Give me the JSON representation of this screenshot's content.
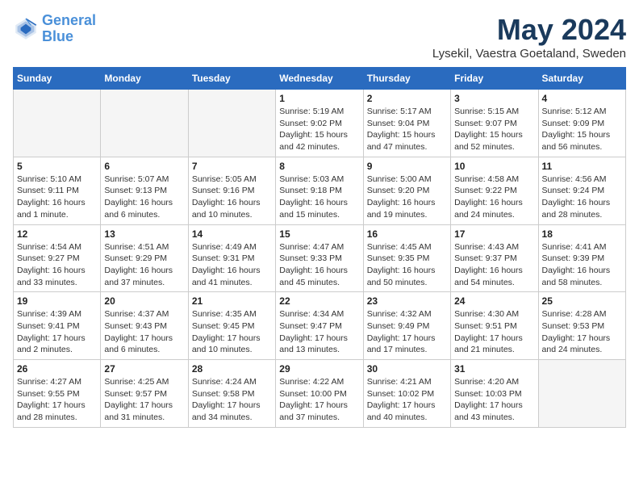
{
  "header": {
    "logo_line1": "General",
    "logo_line2": "Blue",
    "month": "May 2024",
    "location": "Lysekil, Vaestra Goetaland, Sweden"
  },
  "weekdays": [
    "Sunday",
    "Monday",
    "Tuesday",
    "Wednesday",
    "Thursday",
    "Friday",
    "Saturday"
  ],
  "weeks": [
    [
      {
        "date": "",
        "info": ""
      },
      {
        "date": "",
        "info": ""
      },
      {
        "date": "",
        "info": ""
      },
      {
        "date": "1",
        "info": "Sunrise: 5:19 AM\nSunset: 9:02 PM\nDaylight: 15 hours and 42 minutes."
      },
      {
        "date": "2",
        "info": "Sunrise: 5:17 AM\nSunset: 9:04 PM\nDaylight: 15 hours and 47 minutes."
      },
      {
        "date": "3",
        "info": "Sunrise: 5:15 AM\nSunset: 9:07 PM\nDaylight: 15 hours and 52 minutes."
      },
      {
        "date": "4",
        "info": "Sunrise: 5:12 AM\nSunset: 9:09 PM\nDaylight: 15 hours and 56 minutes."
      }
    ],
    [
      {
        "date": "5",
        "info": "Sunrise: 5:10 AM\nSunset: 9:11 PM\nDaylight: 16 hours and 1 minute."
      },
      {
        "date": "6",
        "info": "Sunrise: 5:07 AM\nSunset: 9:13 PM\nDaylight: 16 hours and 6 minutes."
      },
      {
        "date": "7",
        "info": "Sunrise: 5:05 AM\nSunset: 9:16 PM\nDaylight: 16 hours and 10 minutes."
      },
      {
        "date": "8",
        "info": "Sunrise: 5:03 AM\nSunset: 9:18 PM\nDaylight: 16 hours and 15 minutes."
      },
      {
        "date": "9",
        "info": "Sunrise: 5:00 AM\nSunset: 9:20 PM\nDaylight: 16 hours and 19 minutes."
      },
      {
        "date": "10",
        "info": "Sunrise: 4:58 AM\nSunset: 9:22 PM\nDaylight: 16 hours and 24 minutes."
      },
      {
        "date": "11",
        "info": "Sunrise: 4:56 AM\nSunset: 9:24 PM\nDaylight: 16 hours and 28 minutes."
      }
    ],
    [
      {
        "date": "12",
        "info": "Sunrise: 4:54 AM\nSunset: 9:27 PM\nDaylight: 16 hours and 33 minutes."
      },
      {
        "date": "13",
        "info": "Sunrise: 4:51 AM\nSunset: 9:29 PM\nDaylight: 16 hours and 37 minutes."
      },
      {
        "date": "14",
        "info": "Sunrise: 4:49 AM\nSunset: 9:31 PM\nDaylight: 16 hours and 41 minutes."
      },
      {
        "date": "15",
        "info": "Sunrise: 4:47 AM\nSunset: 9:33 PM\nDaylight: 16 hours and 45 minutes."
      },
      {
        "date": "16",
        "info": "Sunrise: 4:45 AM\nSunset: 9:35 PM\nDaylight: 16 hours and 50 minutes."
      },
      {
        "date": "17",
        "info": "Sunrise: 4:43 AM\nSunset: 9:37 PM\nDaylight: 16 hours and 54 minutes."
      },
      {
        "date": "18",
        "info": "Sunrise: 4:41 AM\nSunset: 9:39 PM\nDaylight: 16 hours and 58 minutes."
      }
    ],
    [
      {
        "date": "19",
        "info": "Sunrise: 4:39 AM\nSunset: 9:41 PM\nDaylight: 17 hours and 2 minutes."
      },
      {
        "date": "20",
        "info": "Sunrise: 4:37 AM\nSunset: 9:43 PM\nDaylight: 17 hours and 6 minutes."
      },
      {
        "date": "21",
        "info": "Sunrise: 4:35 AM\nSunset: 9:45 PM\nDaylight: 17 hours and 10 minutes."
      },
      {
        "date": "22",
        "info": "Sunrise: 4:34 AM\nSunset: 9:47 PM\nDaylight: 17 hours and 13 minutes."
      },
      {
        "date": "23",
        "info": "Sunrise: 4:32 AM\nSunset: 9:49 PM\nDaylight: 17 hours and 17 minutes."
      },
      {
        "date": "24",
        "info": "Sunrise: 4:30 AM\nSunset: 9:51 PM\nDaylight: 17 hours and 21 minutes."
      },
      {
        "date": "25",
        "info": "Sunrise: 4:28 AM\nSunset: 9:53 PM\nDaylight: 17 hours and 24 minutes."
      }
    ],
    [
      {
        "date": "26",
        "info": "Sunrise: 4:27 AM\nSunset: 9:55 PM\nDaylight: 17 hours and 28 minutes."
      },
      {
        "date": "27",
        "info": "Sunrise: 4:25 AM\nSunset: 9:57 PM\nDaylight: 17 hours and 31 minutes."
      },
      {
        "date": "28",
        "info": "Sunrise: 4:24 AM\nSunset: 9:58 PM\nDaylight: 17 hours and 34 minutes."
      },
      {
        "date": "29",
        "info": "Sunrise: 4:22 AM\nSunset: 10:00 PM\nDaylight: 17 hours and 37 minutes."
      },
      {
        "date": "30",
        "info": "Sunrise: 4:21 AM\nSunset: 10:02 PM\nDaylight: 17 hours and 40 minutes."
      },
      {
        "date": "31",
        "info": "Sunrise: 4:20 AM\nSunset: 10:03 PM\nDaylight: 17 hours and 43 minutes."
      },
      {
        "date": "",
        "info": ""
      }
    ]
  ]
}
